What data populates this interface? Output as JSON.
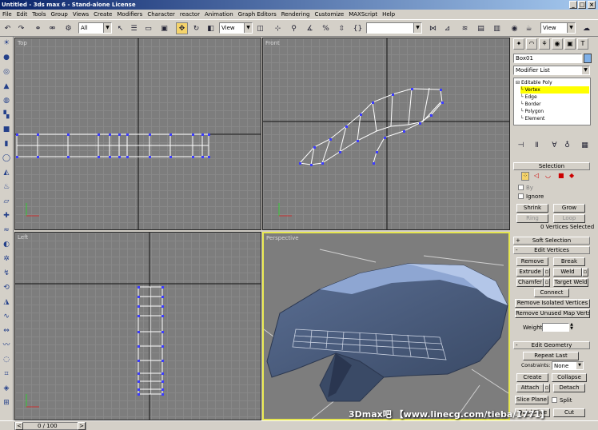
{
  "window": {
    "title": "Untitled - 3ds max 6 - Stand-alone License",
    "min": "_",
    "max": "□",
    "close": "×"
  },
  "menu": [
    "File",
    "Edit",
    "Tools",
    "Group",
    "Views",
    "Create",
    "Modifiers",
    "Character",
    "reactor",
    "Animation",
    "Graph Editors",
    "Rendering",
    "Customize",
    "MAXScript",
    "Help"
  ],
  "toolbar": {
    "selection_filter": "All",
    "ref_coord": "View",
    "named_sel": "",
    "ref_coord2": "View"
  },
  "viewports": {
    "top": "Top",
    "front": "Front",
    "left": "Left",
    "perspective": "Perspective"
  },
  "command_panel": {
    "object_name": "Box01",
    "modifier_list": "Modifier List",
    "stack": {
      "root": "Editable Poly",
      "items": [
        "Vertex",
        "Edge",
        "Border",
        "Polygon",
        "Element"
      ],
      "selected": "Vertex"
    },
    "selection": {
      "title": "Selection",
      "by": "By",
      "ignore": "Ignore",
      "shrink": "Shrink",
      "grow": "Grow",
      "ring": "Ring",
      "loop": "Loop",
      "status": "0 Vertices Selected"
    },
    "soft_selection": {
      "title": "Soft Selection",
      "toggle": "+"
    },
    "edit_vertices": {
      "title": "Edit Vertices",
      "toggle": "-",
      "remove": "Remove",
      "break": "Break",
      "extrude": "Extrude",
      "weld": "Weld",
      "chamfer": "Chamfer",
      "target_weld": "Target Weld",
      "connect": "Connect",
      "remove_isolated": "Remove Isolated Vertices",
      "remove_unused": "Remove Unused Map Verts",
      "weight_label": "Weight:",
      "weight_value": ""
    },
    "edit_geometry": {
      "title": "Edit Geometry",
      "toggle": "-",
      "repeat_last": "Repeat Last",
      "constraints_label": "Constraints:",
      "constraints_value": "None",
      "create": "Create",
      "collapse": "Collapse",
      "attach": "Attach",
      "detach": "Detach",
      "slice_plane": "Slice Plane",
      "split": "Split",
      "quickslice": "QuickSlice",
      "cut": "Cut"
    }
  },
  "status": {
    "frame": "0 / 100",
    "prev": "<",
    "next": ">"
  },
  "watermark": "3Dmax吧 【www.linecg.com/tieba/1771】",
  "colors": {
    "selected_item": "#ffff00",
    "active_viewport": "#e6e650",
    "vertex": "#3c3cff",
    "grid": "#7d7d7d",
    "title_bar": "#0a246a"
  }
}
